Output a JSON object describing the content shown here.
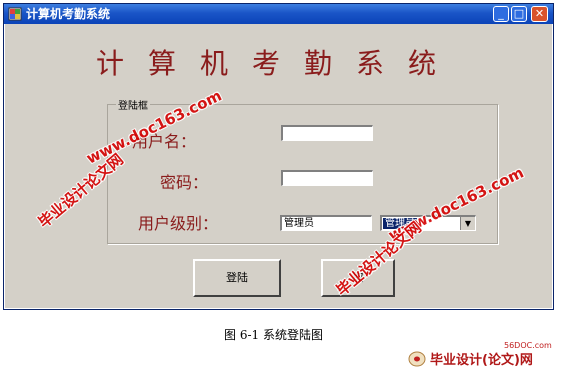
{
  "window": {
    "title": "计算机考勤系统",
    "controls": {
      "minimize": "_",
      "maximize": "□",
      "close": "✕"
    }
  },
  "heading": "计算机考勤系统",
  "group": {
    "legend": "登陆框"
  },
  "form": {
    "username_label": "用户名：",
    "username_value": "",
    "password_label": "密码：",
    "password_value": "",
    "level_label": "用户级别：",
    "level_text": "管理员",
    "level_select_value": "管理员",
    "level_select_arrow": "▼"
  },
  "buttons": {
    "login": "登陆",
    "second": "取"
  },
  "caption": "图 6-1 系统登陆图",
  "watermarks": {
    "domain": "www.doc163.com",
    "site": "毕业设计论文网"
  },
  "corner": {
    "site": "56DOC.com",
    "logo": "毕业设计(论文)网"
  },
  "colors": {
    "label_red": "#8a1c1c",
    "title_blue": "#0b43b8",
    "watermark_red": "#d40000"
  },
  "icons": [
    "app-icon",
    "minimize-icon",
    "maximize-icon",
    "close-icon",
    "dropdown-arrow-icon"
  ]
}
